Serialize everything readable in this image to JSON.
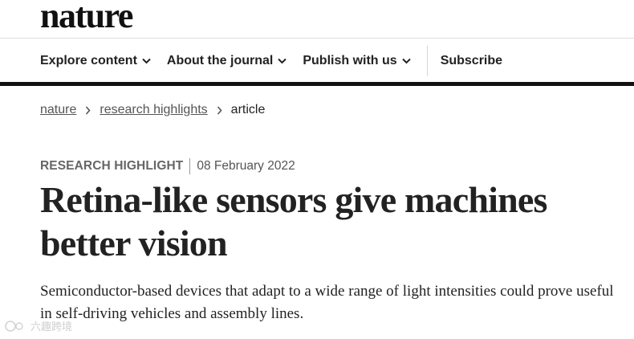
{
  "header": {
    "logo": "nature"
  },
  "nav": {
    "items": [
      {
        "label": "Explore content",
        "has_dropdown": true
      },
      {
        "label": "About the journal",
        "has_dropdown": true
      },
      {
        "label": "Publish with us",
        "has_dropdown": true
      }
    ],
    "subscribe": "Subscribe"
  },
  "breadcrumb": [
    {
      "label": "nature"
    },
    {
      "label": "research highlights"
    },
    {
      "label": "article"
    }
  ],
  "article": {
    "type": "RESEARCH HIGHLIGHT",
    "date": "08 February 2022",
    "title": "Retina-like sensors give machines better vision",
    "standfirst": "Semiconductor-based devices that adapt to a wide range of light intensities could prove useful in self-driving vehicles and assembly lines."
  },
  "watermark": {
    "text": "六趣跨境"
  },
  "icons": {
    "dropdown": "chevron-down-icon",
    "breadcrumb_sep": "chevron-right-icon"
  },
  "colors": {
    "text": "#222222",
    "rule": "#111111",
    "muted": "#666666"
  }
}
